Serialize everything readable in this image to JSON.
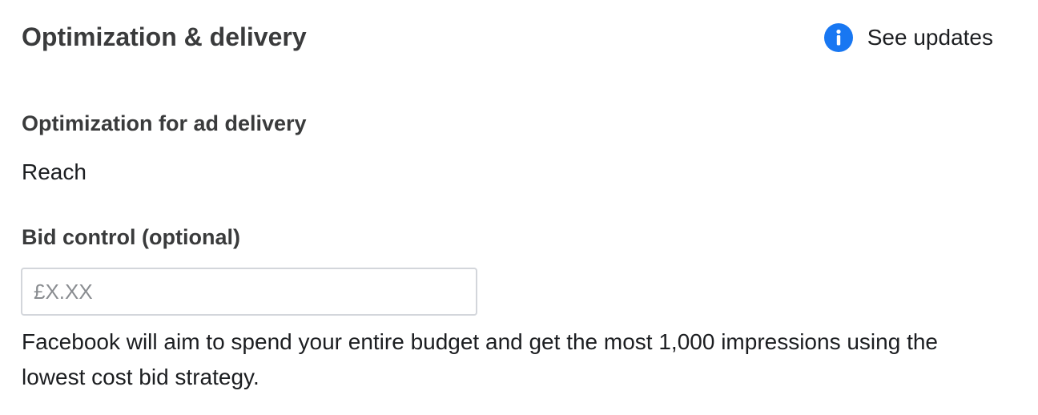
{
  "section": {
    "title": "Optimization & delivery",
    "see_updates_label": "See updates",
    "info_icon": "info-icon",
    "accent_color": "#1877f2"
  },
  "optimization": {
    "label": "Optimization for ad delivery",
    "value": "Reach"
  },
  "bid_control": {
    "label": "Bid control (optional)",
    "value": "",
    "placeholder": "£X.XX",
    "help_text": "Facebook will aim to spend your entire budget and get the most 1,000 impressions using the lowest cost bid strategy."
  }
}
